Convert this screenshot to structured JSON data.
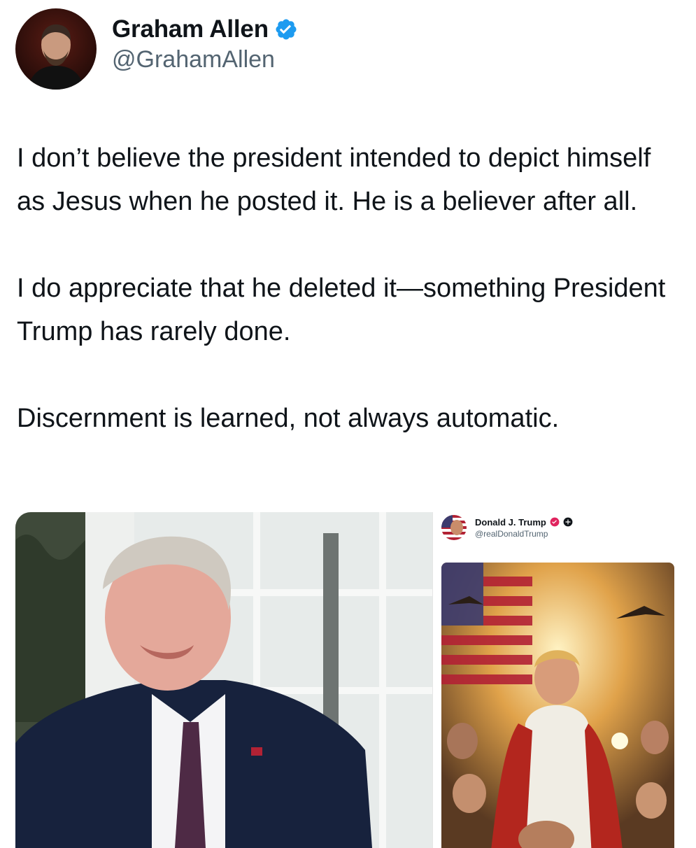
{
  "tweet": {
    "author": {
      "display_name": "Graham Allen",
      "handle": "@GrahamAllen",
      "verified_icon": "verified-badge-icon",
      "verified_color": "#1d9bf0"
    },
    "text": "I don’t believe the president intended to depict himself as Jesus when he posted it. He is a believer after all.\n\nI do appreciate that he deleted it—something President Trump has rarely done.\n\nDiscernment is learned, not always automatic.",
    "media": {
      "left_photo": "photo-of-man-in-suit-speaking",
      "embedded_post": {
        "author_display_name": "Donald J. Trump",
        "author_handle": "@realDonaldTrump",
        "badge_icon": "verified-badge-icon",
        "extra_icon": "plus-icon",
        "image": "painted-illustration-with-american-flag"
      }
    }
  },
  "colors": {
    "text_primary": "#0f1419",
    "text_secondary": "#536471",
    "accent_blue": "#1d9bf0",
    "badge_pink": "#e0245e"
  }
}
